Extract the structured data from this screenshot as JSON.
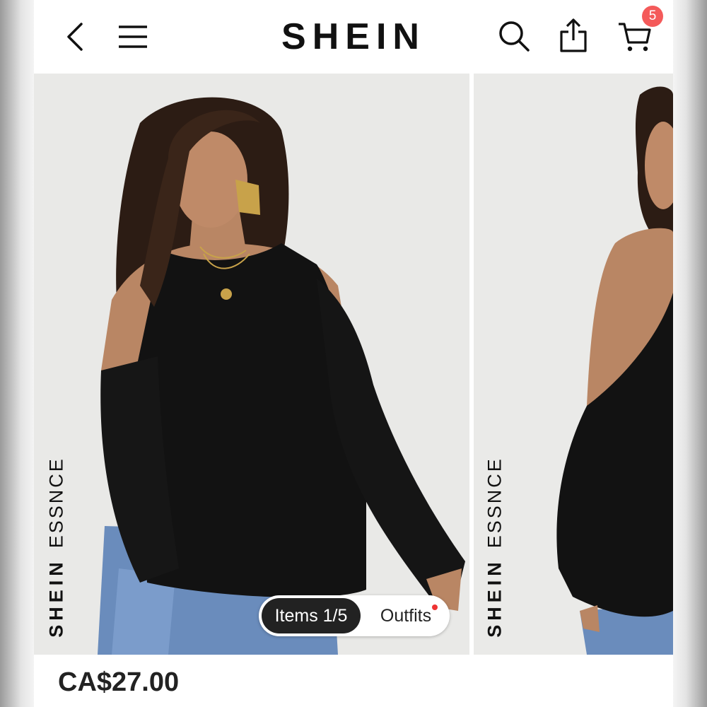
{
  "header": {
    "logo": "SHEIN",
    "cart_count": "5",
    "icons": [
      "back-chevron-icon",
      "hamburger-menu-icon",
      "search-icon",
      "share-icon",
      "cart-icon"
    ]
  },
  "gallery": {
    "slides": [
      {
        "brand_strong": "SHEIN",
        "brand_light": "ESSNCE"
      },
      {
        "brand_strong": "SHEIN",
        "brand_light": "ESSNCE"
      }
    ],
    "switcher": {
      "items_label": "Items 1/5",
      "outfits_label": "Outfits"
    }
  },
  "product": {
    "price": "CA$27.00"
  },
  "colors": {
    "badge": "#f45a5a",
    "pill_active": "#222222",
    "text": "#111111"
  }
}
